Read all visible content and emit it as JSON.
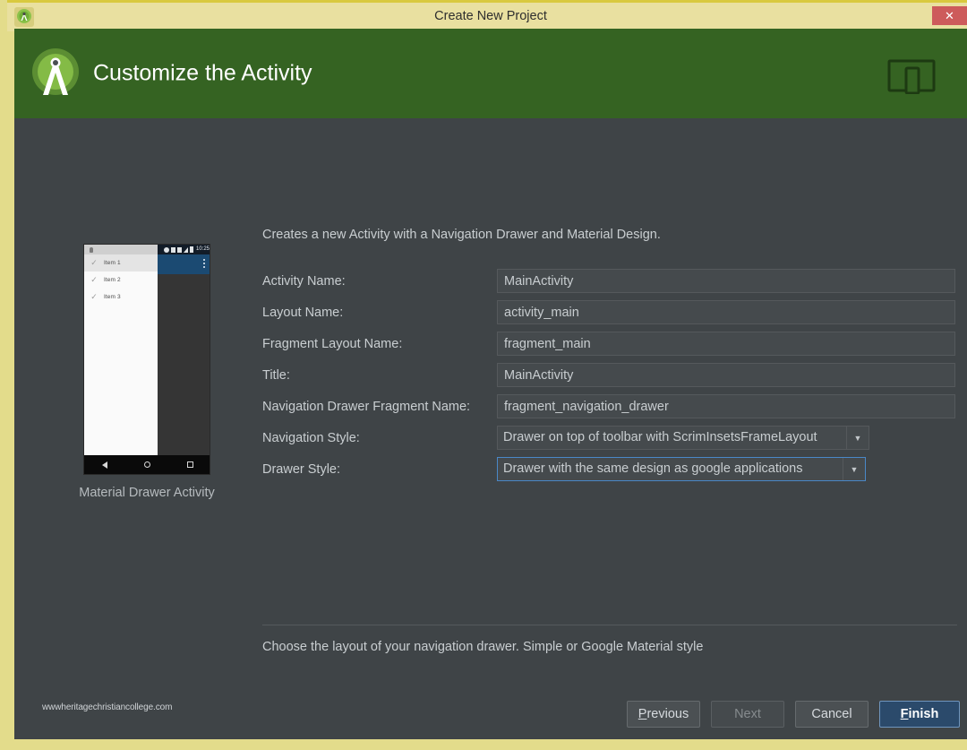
{
  "titlebar": {
    "title": "Create New Project",
    "close_label": "✕",
    "app_icon": "android-studio-icon"
  },
  "banner": {
    "title": "Customize the Activity",
    "logo_icon": "android-studio-logo",
    "right_icon": "device-preview-icon"
  },
  "preview": {
    "caption": "Material Drawer Activity",
    "status_time": "10:25",
    "drawer_items": [
      {
        "label": "Item 1",
        "check": "✓",
        "selected": true
      },
      {
        "label": "Item 2",
        "check": "✓",
        "selected": false
      },
      {
        "label": "Item 3",
        "check": "✓",
        "selected": false
      }
    ],
    "overflow_icon": "overflow-menu-icon",
    "nav_back_icon": "back-triangle-icon",
    "nav_home_icon": "home-circle-icon",
    "nav_recent_icon": "recents-square-icon"
  },
  "form": {
    "description": "Creates a new Activity with a Navigation Drawer and Material Design.",
    "fields": [
      {
        "label": "Activity Name:",
        "value": "MainActivity",
        "type": "text"
      },
      {
        "label": "Layout Name:",
        "value": "activity_main",
        "type": "text"
      },
      {
        "label": "Fragment Layout Name:",
        "value": "fragment_main",
        "type": "text"
      },
      {
        "label": "Title:",
        "value": "MainActivity",
        "type": "text"
      },
      {
        "label": "Navigation Drawer Fragment Name:",
        "value": "fragment_navigation_drawer",
        "type": "text"
      },
      {
        "label": "Navigation Style:",
        "value": "Drawer on top of toolbar with ScrimInsetsFrameLayout",
        "type": "select"
      },
      {
        "label": "Drawer Style:",
        "value": "Drawer with the same design as google applications",
        "type": "select"
      }
    ],
    "dropdown_arrow": "▼",
    "hint": "Choose the layout of your navigation drawer. Simple or Google Material style"
  },
  "watermark": "wwwheritagechristiancollege.com",
  "footer": {
    "previous": {
      "prefix": "",
      "accel": "P",
      "suffix": "revious"
    },
    "next": "Next",
    "cancel": "Cancel",
    "finish": {
      "prefix": "",
      "accel": "F",
      "suffix": "inish"
    }
  },
  "colors": {
    "window_border": "#e3dc8b",
    "titlebar": "#e9e0a0",
    "banner_green": "#356322",
    "body_dark": "#3f4447",
    "focus_blue": "#4a88c7",
    "finish_blue": "#2b4a6b",
    "close_red": "#cd5b5b"
  }
}
